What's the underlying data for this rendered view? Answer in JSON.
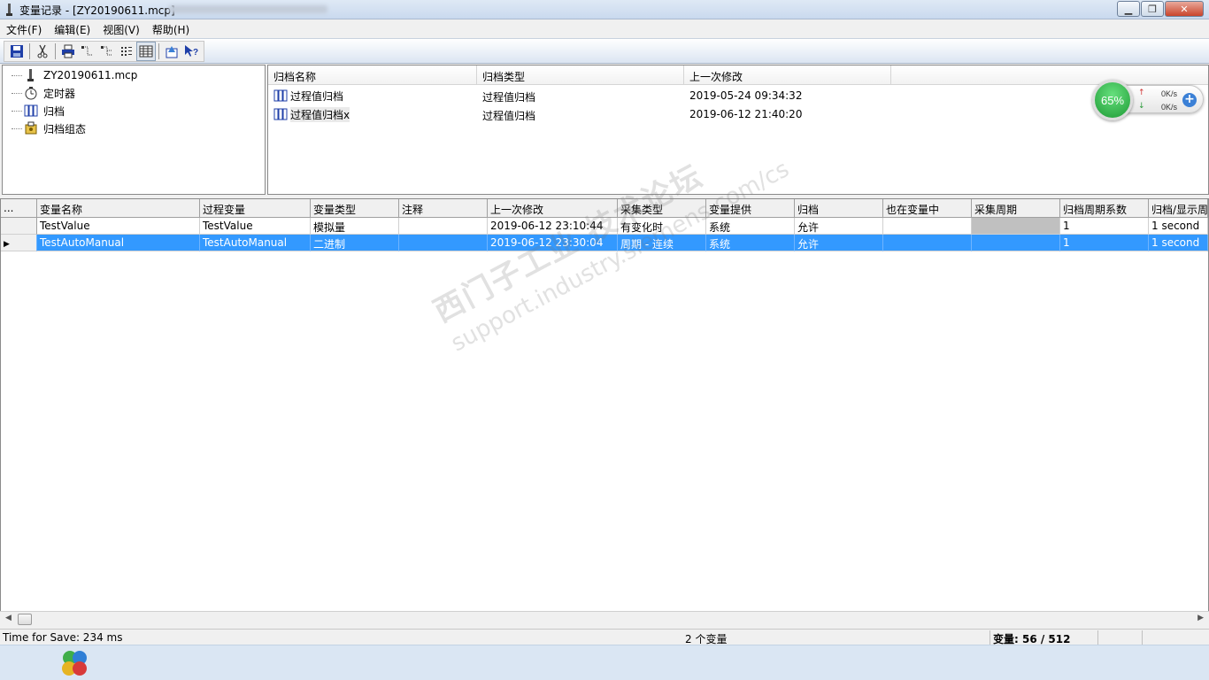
{
  "window": {
    "title": "变量记录 - [ZY20190611.mcp]",
    "buttons": {
      "minimize_icon": "minimize-icon",
      "restore_icon": "restore-icon",
      "close_icon": "close-icon"
    }
  },
  "menu": [
    {
      "label": "文件(F)"
    },
    {
      "label": "编辑(E)"
    },
    {
      "label": "视图(V)"
    },
    {
      "label": "帮助(H)"
    }
  ],
  "toolbar": {
    "icons": [
      "save-icon",
      "cut-icon",
      "print-icon",
      "tree-expand-icon",
      "tree-collapse-icon",
      "list-icon",
      "details-icon",
      "properties-icon",
      "help-icon"
    ]
  },
  "tree": {
    "items": [
      {
        "label": "ZY20190611.mcp",
        "icon": "project-icon"
      },
      {
        "label": "定时器",
        "icon": "timer-icon"
      },
      {
        "label": "归档",
        "icon": "archive-icon"
      },
      {
        "label": "归档组态",
        "icon": "archive-config-icon"
      }
    ]
  },
  "archives": {
    "headers": [
      "归档名称",
      "归档类型",
      "上一次修改"
    ],
    "rows": [
      {
        "name": "过程值归档",
        "type": "过程值归档",
        "modified": "2019-05-24 09:34:32"
      },
      {
        "name": "过程值归档x",
        "type": "过程值归档",
        "modified": "2019-06-12 21:40:20"
      }
    ]
  },
  "network_widget": {
    "percent": "65%",
    "upload": "0K/s",
    "download": "0K/s",
    "accent": "#27a844"
  },
  "grid": {
    "corner_label": "...",
    "headers": [
      "变量名称",
      "过程变量",
      "变量类型",
      "注释",
      "上一次修改",
      "采集类型",
      "变量提供",
      "归档",
      "也在变量中",
      "采集周期",
      "归档周期系数",
      "归档/显示周"
    ],
    "rows": [
      {
        "selected": false,
        "cells": [
          "TestValue",
          "TestValue",
          "模拟量",
          "",
          "2019-06-12 23:10:44",
          "有变化时",
          "系统",
          "允许",
          "",
          "",
          "1",
          "1 second"
        ]
      },
      {
        "selected": true,
        "cells": [
          "TestAutoManual",
          "TestAutoManual",
          "二进制",
          "",
          "2019-06-12 23:30:04",
          "周期 - 连续",
          "系统",
          "允许",
          "",
          "",
          "1",
          "1 second"
        ]
      }
    ],
    "selection_color": "#3399ff"
  },
  "statusbar": {
    "save_time": "Time for Save: 234 ms",
    "count": "2 个变量",
    "variables": "变量: 56 / 512"
  },
  "watermark": {
    "line1": "西门子工业 技术论坛",
    "line2": "support.industry.siemens.com/cs"
  }
}
